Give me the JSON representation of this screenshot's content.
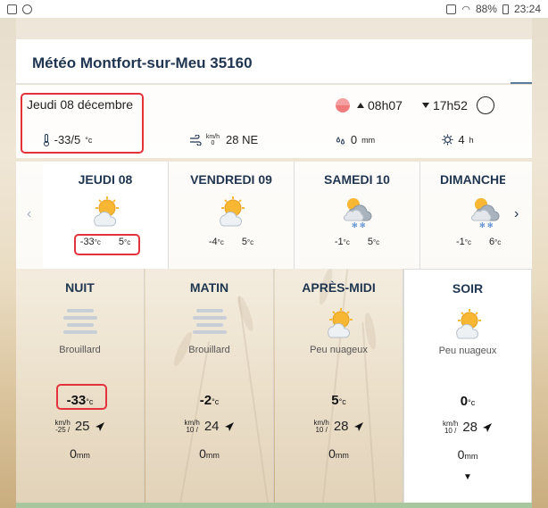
{
  "status_bar": {
    "battery": "88%",
    "time": "23:24"
  },
  "title": "Météo Montfort-sur-Meu 35160",
  "summary": {
    "date": "Jeudi 08 décembre",
    "sunrise": "08h07",
    "sunset": "17h52",
    "temp_range": "-33/5",
    "temp_unit": "°c",
    "wind_unit_top": "km/h",
    "wind_unit_bottom": "0",
    "wind": "28 NE",
    "rain": "0",
    "rain_unit": "mm",
    "sunshine": "4",
    "sunshine_unit": "h"
  },
  "days": [
    {
      "name": "JEUDI 08",
      "min": "-33",
      "max": "5",
      "unit": "°c",
      "icon": "sun-cloud-icon"
    },
    {
      "name": "VENDREDI 09",
      "min": "-4",
      "max": "5",
      "unit": "°c",
      "icon": "sun-cloud-icon"
    },
    {
      "name": "SAMEDI 10",
      "min": "-1",
      "max": "5",
      "unit": "°c",
      "icon": "snow-cloud-icon"
    },
    {
      "name": "DIMANCHE",
      "min": "-1",
      "max": "6",
      "unit": "°c",
      "icon": "snow-cloud-icon"
    }
  ],
  "periods": [
    {
      "name": "NUIT",
      "desc": "Brouillard",
      "temp": "-33",
      "unit": "°c",
      "wind_top": "km/h",
      "wind_bottom": "-25 /",
      "wind": "25",
      "rain": "0",
      "rain_unit": "mm",
      "icon": "fog-icon"
    },
    {
      "name": "MATIN",
      "desc": "Brouillard",
      "temp": "-2",
      "unit": "°c",
      "wind_top": "km/h",
      "wind_bottom": "10 /",
      "wind": "24",
      "rain": "0",
      "rain_unit": "mm",
      "icon": "fog-icon"
    },
    {
      "name": "APRÈS-MIDI",
      "desc": "Peu nuageux",
      "temp": "5",
      "unit": "°c",
      "wind_top": "km/h",
      "wind_bottom": "10 /",
      "wind": "28",
      "rain": "0",
      "rain_unit": "mm",
      "icon": "sun-cloud-icon"
    },
    {
      "name": "SOIR",
      "desc": "Peu nuageux",
      "temp": "0",
      "unit": "°c",
      "wind_top": "km/h",
      "wind_bottom": "10 /",
      "wind": "28",
      "rain": "0",
      "rain_unit": "mm",
      "icon": "sun-cloud-icon"
    }
  ],
  "colors": {
    "title": "#1f3550",
    "highlight": "#e3323c"
  }
}
